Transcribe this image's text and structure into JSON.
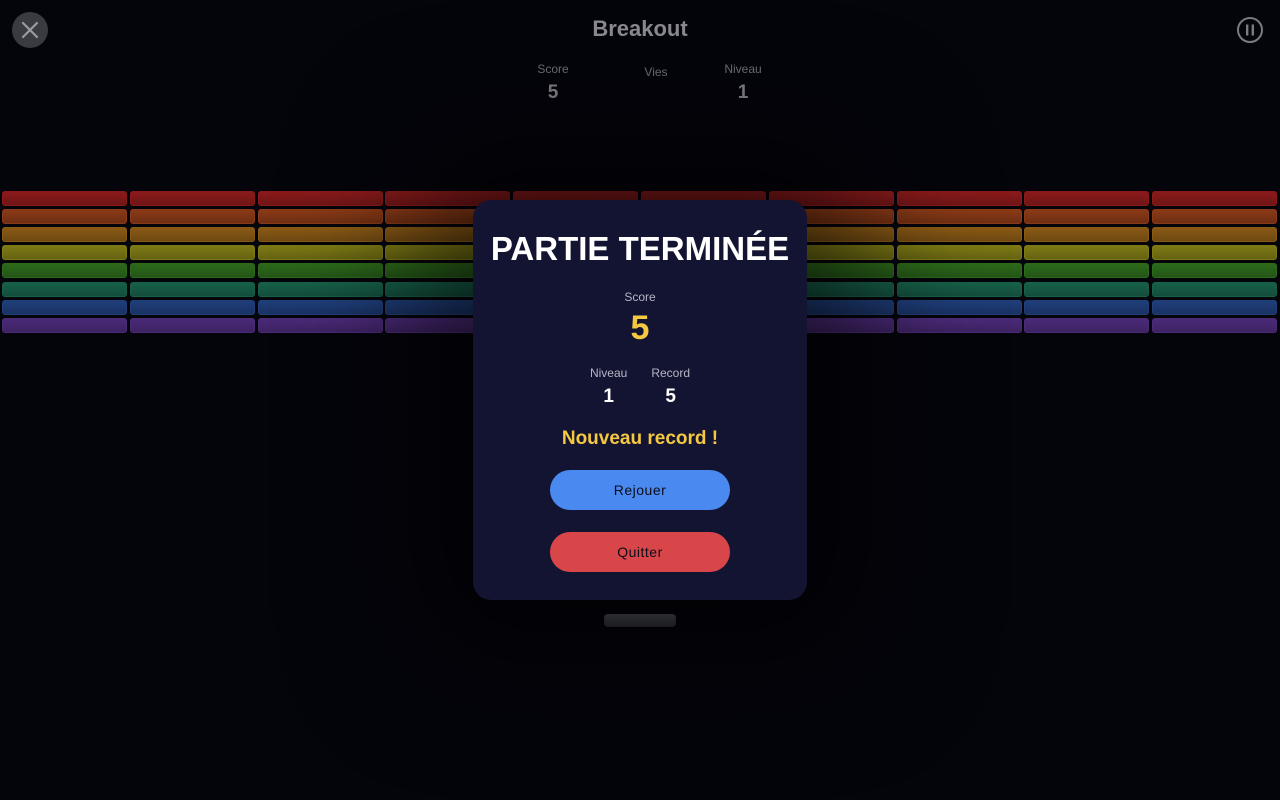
{
  "header": {
    "title": "Breakout",
    "close_icon": "close-icon",
    "pause_icon": "pause-icon"
  },
  "hud": {
    "score_label": "Score",
    "score_value": "5",
    "lives_label": "Vies",
    "level_label": "Niveau",
    "level_value": "1"
  },
  "bricks": {
    "rows": 8,
    "cols": 10,
    "row_colors": [
      "#8a1a1a",
      "#8a3a16",
      "#8a5a14",
      "#7d7a14",
      "#2c6a1a",
      "#176048",
      "#1f3e7a",
      "#4b2a78"
    ]
  },
  "modal": {
    "title": "PARTIE TERMINÉE",
    "score_label": "Score",
    "score_value": "5",
    "level_label": "Niveau",
    "level_value": "1",
    "record_label": "Record",
    "record_value": "5",
    "new_record_message": "Nouveau record !",
    "replay_label": "Rejouer",
    "quit_label": "Quitter",
    "replay_color": "#4a8af0",
    "quit_color": "#d9464a",
    "highlight_color": "#f5c842"
  }
}
